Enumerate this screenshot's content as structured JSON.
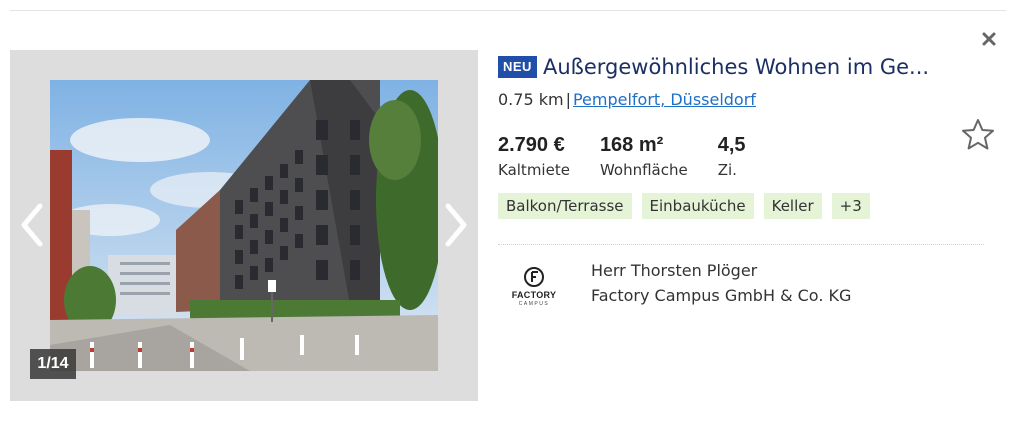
{
  "listing": {
    "badge": "NEU",
    "title": "Außergewöhnliches Wohnen im Ge...",
    "distance": "0.75 km",
    "separator": "|",
    "location": "Pempelfort, Düsseldorf",
    "facts": [
      {
        "value": "2.790 €",
        "label": "Kaltmiete"
      },
      {
        "value": "168 m²",
        "label": "Wohnfläche"
      },
      {
        "value": "4,5",
        "label": "Zi."
      }
    ],
    "tags": [
      "Balkon/Terrasse",
      "Einbauküche",
      "Keller",
      "+3"
    ]
  },
  "gallery": {
    "counter": "1/14"
  },
  "contact": {
    "name": "Herr Thorsten Plöger",
    "company": "Factory Campus GmbH & Co. KG",
    "logo_text": "FACTORY",
    "logo_subtext": "CAMPUS"
  },
  "icons": {
    "close": "close-icon",
    "star": "star-icon",
    "prev": "chevron-left-icon",
    "next": "chevron-right-icon"
  },
  "colors": {
    "badge": "#1f4fa8",
    "title": "#1b2f63",
    "link": "#1f6fc5",
    "tag_bg": "#e5f4d6"
  }
}
